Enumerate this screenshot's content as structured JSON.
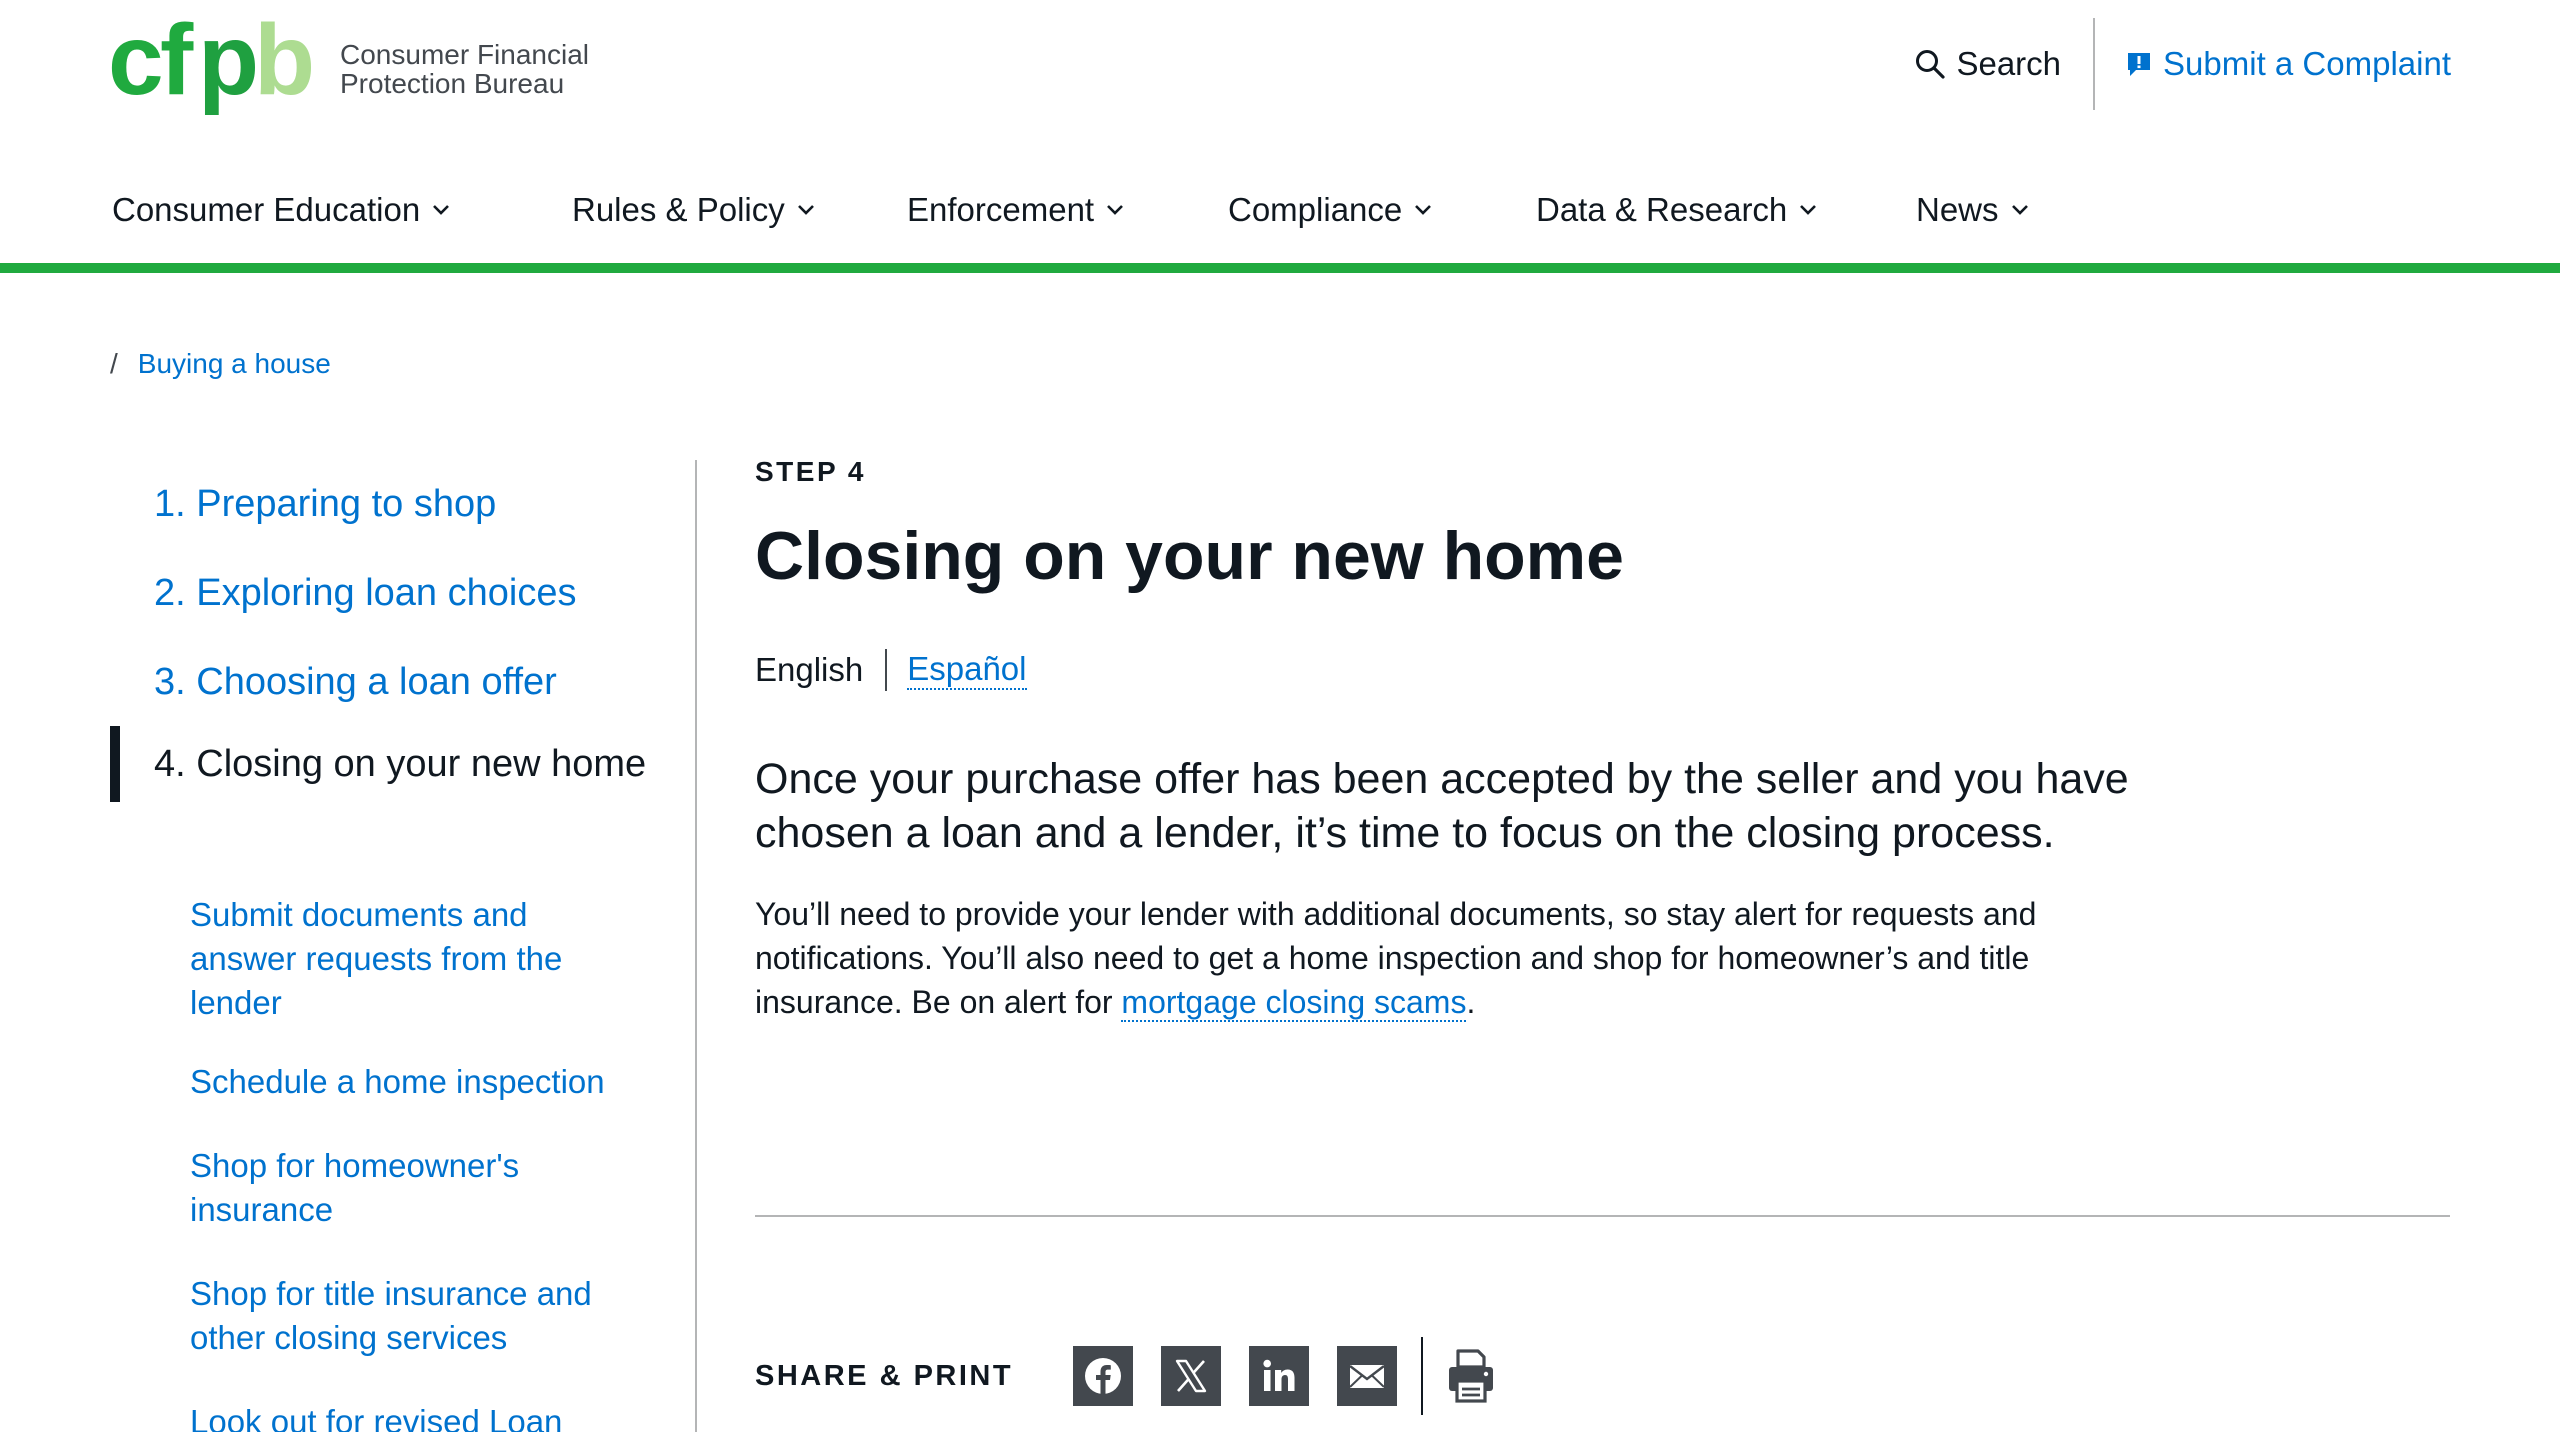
{
  "header": {
    "logo_alt": "cfpb",
    "logo_line1": "Consumer Financial",
    "logo_line2": "Protection Bureau",
    "search_label": "Search",
    "complaint_label": "Submit a Complaint",
    "nav": [
      {
        "label": "Consumer Education"
      },
      {
        "label": "Rules & Policy"
      },
      {
        "label": "Enforcement"
      },
      {
        "label": "Compliance"
      },
      {
        "label": "Data & Research"
      },
      {
        "label": "News"
      }
    ]
  },
  "breadcrumb": {
    "separator": "/",
    "items": [
      {
        "label": "Buying a house"
      }
    ]
  },
  "sidebar": {
    "steps": [
      {
        "label": "1. Preparing to shop"
      },
      {
        "label": "2. Exploring loan choices"
      },
      {
        "label": "3. Choosing a loan offer"
      },
      {
        "label": "4. Closing on your new home"
      }
    ],
    "subitems": [
      {
        "label": "Submit documents and answer requests from the lender"
      },
      {
        "label": "Schedule a home inspection"
      },
      {
        "label": "Shop for homeowner's insurance"
      },
      {
        "label": "Shop for title insurance and other closing services"
      },
      {
        "label": "Look out for revised Loan"
      }
    ]
  },
  "main": {
    "eyebrow": "STEP 4",
    "title": "Closing on your new home",
    "lang_current": "English",
    "lang_alt": "Español",
    "lead": "Once your purchase offer has been accepted by the seller and you have chosen a loan and a lender, it’s time to focus on the closing process.",
    "body_before_link": "You’ll need to provide your lender with additional documents, so stay alert for requests and notifications. You’ll also need to get a home inspection and shop for homeowner’s and title insurance. Be on alert for ",
    "body_link": "mortgage closing scams",
    "body_after_link": "."
  },
  "share": {
    "label": "SHARE & PRINT",
    "icons": [
      "facebook-icon",
      "x-icon",
      "linkedin-icon",
      "email-icon",
      "print-icon"
    ]
  },
  "colors": {
    "brand_green": "#20aa3f",
    "link_blue": "#0072ce",
    "text": "#101820",
    "gray": "#43484e"
  }
}
